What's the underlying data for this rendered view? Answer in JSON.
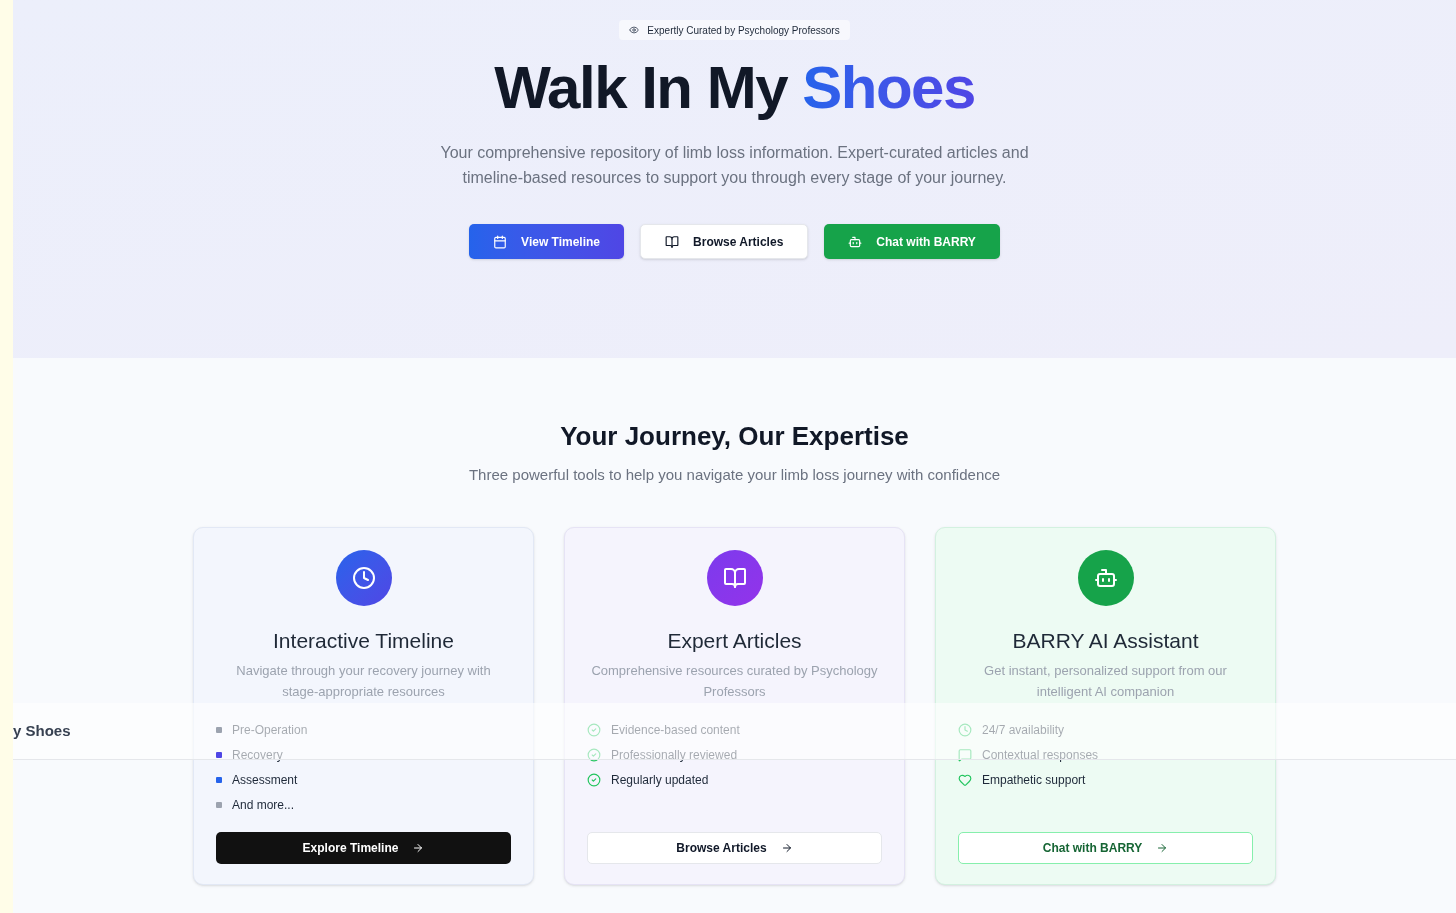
{
  "hero": {
    "badge": "Expertly Curated by Psychology Professors",
    "title": "Walk In My",
    "title_highlight": "Shoes",
    "subtitle": "Your comprehensive repository of limb loss information. Expert-curated articles and timeline-based resources to support you through every stage of your journey.",
    "buttons": [
      {
        "label": "View Timeline",
        "kind": "timeline"
      },
      {
        "label": "Browse Articles",
        "kind": "articles"
      },
      {
        "label": "Chat with BARRY",
        "kind": "assistant"
      }
    ]
  },
  "features": {
    "heading": "Your Journey, Our Expertise",
    "subheading": "Three powerful tools to help you navigate your limb loss journey with confidence",
    "cards": [
      {
        "kind": "timeline",
        "title": "Interactive Timeline",
        "description": "Navigate through your recovery journey with stage-appropriate resources",
        "items": [
          {
            "kind": "dot",
            "label": "Pre-Operation",
            "color": "#9ca3af"
          },
          {
            "kind": "dot",
            "label": "Recovery",
            "color": "#4f46e5"
          },
          {
            "kind": "dot",
            "label": "Assessment",
            "color": "#2563eb"
          },
          {
            "kind": "dot",
            "label": "And more...",
            "color": "#9ca3af"
          }
        ],
        "button": {
          "label": "Explore Timeline",
          "kind": "dark"
        }
      },
      {
        "kind": "articles",
        "title": "Expert Articles",
        "description": "Comprehensive resources curated by Psychology Professors",
        "items": [
          {
            "kind": "check",
            "label": "Evidence-based content"
          },
          {
            "kind": "check",
            "label": "Professionally reviewed"
          },
          {
            "kind": "check",
            "label": "Regularly updated"
          }
        ],
        "button": {
          "label": "Browse Articles",
          "kind": "outline"
        }
      },
      {
        "kind": "assistant",
        "title": "BARRY AI Assistant",
        "description": "Get instant, personalized support from our intelligent AI companion",
        "items": [
          {
            "kind": "clock",
            "label": "24/7 availability"
          },
          {
            "kind": "message",
            "label": "Contextual responses"
          },
          {
            "kind": "heart",
            "label": "Empathetic support"
          }
        ],
        "button": {
          "label": "Chat with BARRY",
          "kind": "outline-green"
        }
      }
    ]
  },
  "sticky_header": {
    "brand": "y Shoes"
  }
}
